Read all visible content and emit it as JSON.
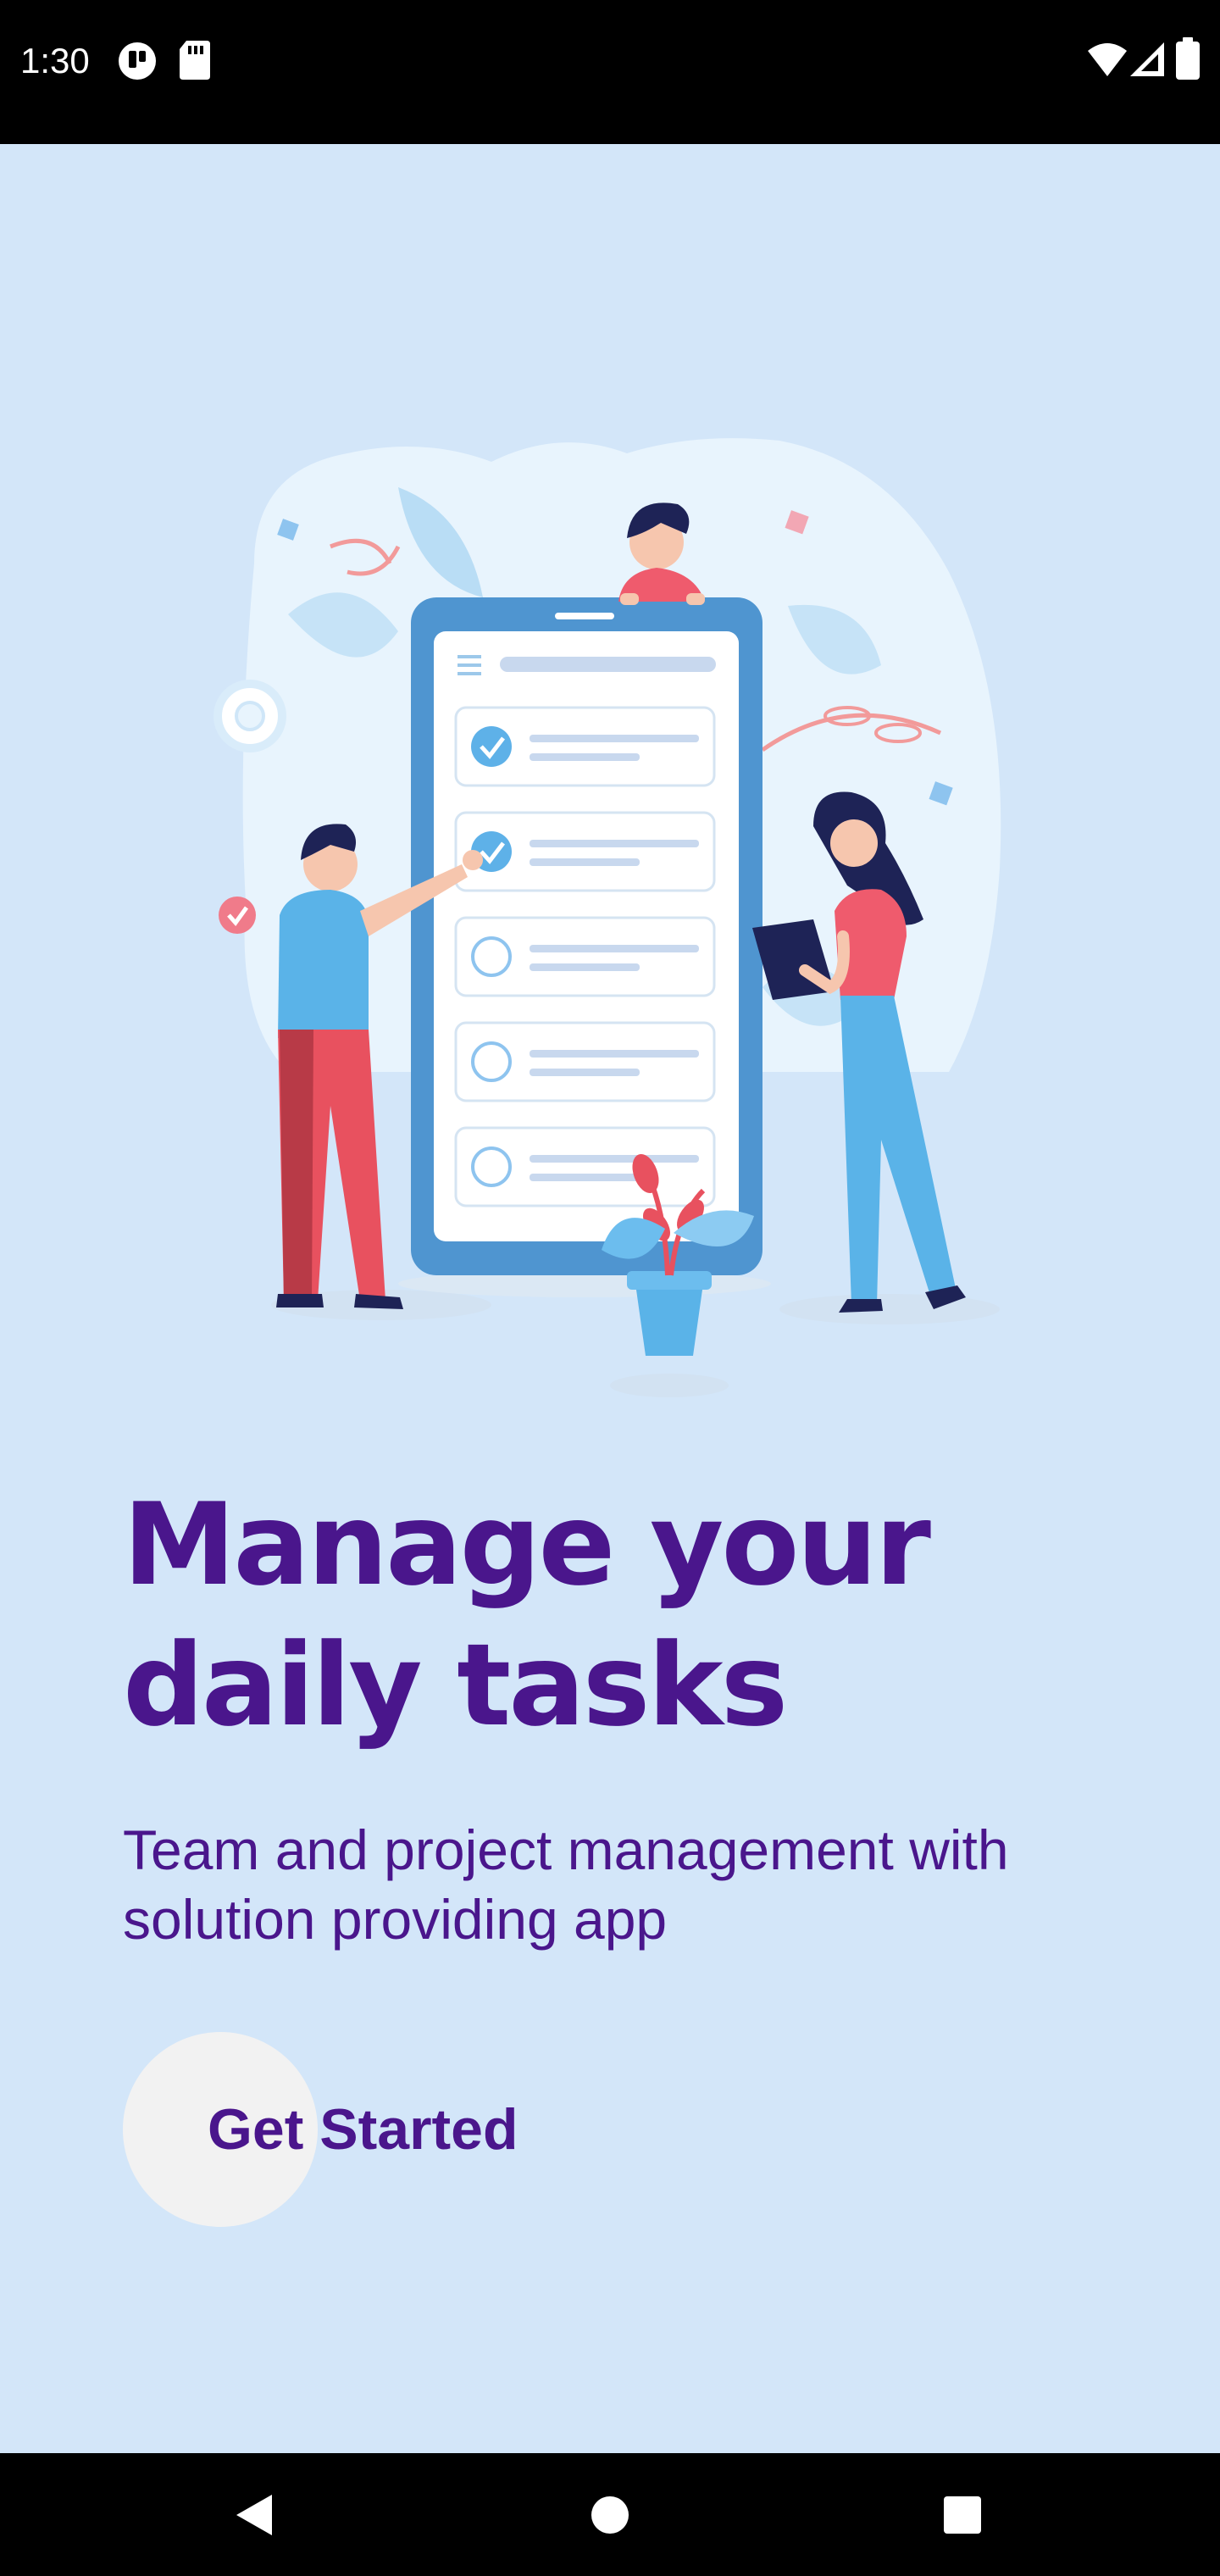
{
  "status_bar": {
    "time": "1:30",
    "left_icons": [
      "notification-app-icon",
      "sd-card-icon"
    ],
    "right_icons": [
      "wifi-icon",
      "cellular-signal-icon",
      "battery-icon"
    ]
  },
  "onboarding": {
    "illustration": "task-checklist-illustration",
    "headline": "Manage your daily tasks",
    "subtitle": "Team and project management with solution providing app",
    "cta_label": "Get Started"
  },
  "navigation_bar": {
    "buttons": [
      "back-icon",
      "home-icon",
      "recents-icon"
    ]
  },
  "colors": {
    "background": "#d3e6f9",
    "text_primary": "#4a168c",
    "cta_circle": "#f2f2f2"
  }
}
